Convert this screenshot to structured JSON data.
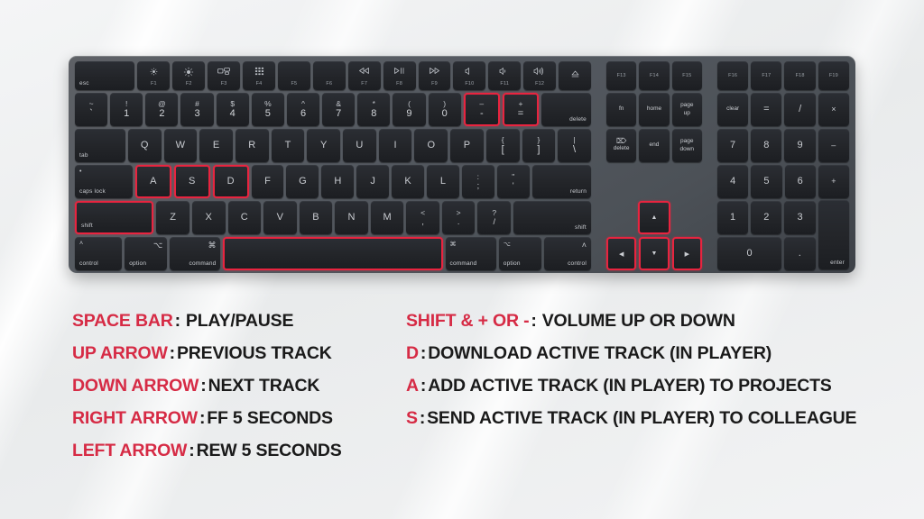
{
  "theme": {
    "accent_red": "#d62b45",
    "highlight_red": "#e8243f",
    "key_dark": "#232529",
    "chassis_gray": "#545960",
    "background": "#eef0f1",
    "text_dark": "#1a1a1a"
  },
  "keyboard": {
    "function_row": [
      {
        "name": "esc",
        "label": "esc",
        "glyph": "",
        "width": "w-esc",
        "style": "fn-only"
      },
      {
        "name": "f1",
        "label": "F1",
        "glyph": "☼",
        "style": "fn"
      },
      {
        "name": "f2",
        "label": "F2",
        "glyph": "☀",
        "style": "fn"
      },
      {
        "name": "f3",
        "label": "F3",
        "glyph": "mission-control",
        "style": "fn"
      },
      {
        "name": "f4",
        "label": "F4",
        "glyph": "launchpad",
        "style": "fn"
      },
      {
        "name": "f5",
        "label": "F5",
        "glyph": "",
        "style": "fn"
      },
      {
        "name": "f6",
        "label": "F6",
        "glyph": "",
        "style": "fn"
      },
      {
        "name": "f7",
        "label": "F7",
        "glyph": "⏪",
        "style": "fn"
      },
      {
        "name": "f8",
        "label": "F8",
        "glyph": "⏯",
        "style": "fn"
      },
      {
        "name": "f9",
        "label": "F9",
        "glyph": "⏩",
        "style": "fn"
      },
      {
        "name": "f10",
        "label": "F10",
        "glyph": "ὐ7",
        "style": "fn"
      },
      {
        "name": "f11",
        "label": "F11",
        "glyph": "volume-down",
        "style": "fn"
      },
      {
        "name": "f12",
        "label": "F12",
        "glyph": "volume-up",
        "style": "fn"
      },
      {
        "name": "eject",
        "label": "",
        "glyph": "⏏",
        "style": "fn-glyph-only"
      }
    ],
    "function_row_right": [
      "F13",
      "F14",
      "F15"
    ],
    "function_row_far_right": [
      "F16",
      "F17",
      "F18",
      "F19"
    ],
    "number_row": [
      {
        "top": "~",
        "bot": "`"
      },
      {
        "top": "!",
        "bot": "1"
      },
      {
        "top": "@",
        "bot": "2"
      },
      {
        "top": "#",
        "bot": "3"
      },
      {
        "top": "$",
        "bot": "4"
      },
      {
        "top": "%",
        "bot": "5"
      },
      {
        "top": "^",
        "bot": "6"
      },
      {
        "top": "&",
        "bot": "7"
      },
      {
        "top": "*",
        "bot": "8"
      },
      {
        "top": "(",
        "bot": "9"
      },
      {
        "top": ")",
        "bot": "0"
      },
      {
        "top": "–",
        "bot": "-",
        "highlight": true,
        "name": "minus"
      },
      {
        "top": "+",
        "bot": "=",
        "highlight": true,
        "name": "plus"
      }
    ],
    "delete_label": "delete",
    "qwerty_row": {
      "tab_label": "tab",
      "keys": [
        "Q",
        "W",
        "E",
        "R",
        "T",
        "Y",
        "U",
        "I",
        "O",
        "P"
      ],
      "brackets": [
        {
          "top": "{",
          "bot": "["
        },
        {
          "top": "}",
          "bot": "]"
        }
      ],
      "backslash": {
        "top": "|",
        "bot": "\\"
      }
    },
    "home_row": {
      "caps_top": "•",
      "caps_label": "caps lock",
      "keys": [
        {
          "label": "A",
          "highlight": true
        },
        {
          "label": "S",
          "highlight": true
        },
        {
          "label": "D",
          "highlight": true
        },
        {
          "label": "F"
        },
        {
          "label": "G"
        },
        {
          "label": "H"
        },
        {
          "label": "J"
        },
        {
          "label": "K"
        },
        {
          "label": "L"
        }
      ],
      "semicolon": {
        "top": ":",
        "bot": ";"
      },
      "quote": {
        "top": "\"",
        "bot": "'"
      },
      "return_label": "return"
    },
    "bottom_letter_row": {
      "shift_label": "shift",
      "shift_highlight": true,
      "keys": [
        "Z",
        "X",
        "C",
        "V",
        "B",
        "N",
        "M"
      ],
      "comma": {
        "top": "<",
        "bot": ","
      },
      "period": {
        "top": ">",
        "bot": "."
      },
      "slash": {
        "top": "?",
        "bot": "/"
      },
      "shift_right_label": "shift"
    },
    "modifier_row": {
      "control_left": {
        "glyph": "˄",
        "label": "control"
      },
      "option_left": {
        "glyph": "⌥",
        "label": "option"
      },
      "command_left": {
        "glyph": "⌘",
        "label": "command"
      },
      "space": {
        "label": "",
        "highlight": true
      },
      "command_right": {
        "glyph": "⌘",
        "label": "command"
      },
      "option_right": {
        "glyph": "⌥",
        "label": "option"
      },
      "control_right": {
        "glyph": "˄",
        "label": "control"
      }
    },
    "nav_cluster": {
      "row1": [
        "fn",
        "home",
        "page\nup"
      ],
      "row2_delete_glyph": "⌧",
      "row2": [
        "delete",
        "end",
        "page\ndown"
      ],
      "arrows": {
        "up": {
          "glyph": "▲",
          "highlight": true
        },
        "left": {
          "glyph": "◀",
          "highlight": true
        },
        "down": {
          "glyph": "▼",
          "highlight": true
        },
        "right": {
          "glyph": "▶",
          "highlight": true
        }
      }
    },
    "numpad": {
      "row1": [
        "clear",
        "=",
        "/",
        "×"
      ],
      "row2": [
        "7",
        "8",
        "9",
        "–"
      ],
      "row3": [
        "4",
        "5",
        "6",
        "+"
      ],
      "row4": [
        "1",
        "2",
        "3"
      ],
      "row5": [
        "0",
        "."
      ],
      "enter_label": "enter"
    }
  },
  "legend": {
    "left_column": [
      {
        "key": "SPACE BAR",
        "sep": ":",
        "value": "PLAY/PAUSE",
        "extra_pad": true
      },
      {
        "key": "UP ARROW",
        "sep": ":",
        "value": "PREVIOUS TRACK",
        "extra_pad": false
      },
      {
        "key": "DOWN ARROW",
        "sep": ":",
        "value": "NEXT TRACK",
        "extra_pad": false
      },
      {
        "key": "RIGHT ARROW",
        "sep": ":",
        "value": "FF 5 SECONDS",
        "extra_pad": false
      },
      {
        "key": "LEFT ARROW",
        "sep": ":",
        "value": "REW 5 SECONDS",
        "extra_pad": false
      }
    ],
    "right_column": [
      {
        "key": "SHIFT & + OR -",
        "sep": ":",
        "value": "VOLUME UP OR DOWN",
        "extra_pad": true
      },
      {
        "key": "D",
        "sep": ":",
        "value": "DOWNLOAD ACTIVE TRACK (IN PLAYER)",
        "extra_pad": false
      },
      {
        "key": "A",
        "sep": ":",
        "value": "ADD ACTIVE TRACK (IN PLAYER) TO PROJECTS",
        "extra_pad": false
      },
      {
        "key": "S",
        "sep": ":",
        "value": "SEND ACTIVE TRACK (IN PLAYER) TO COLLEAGUE",
        "extra_pad": false
      }
    ]
  }
}
